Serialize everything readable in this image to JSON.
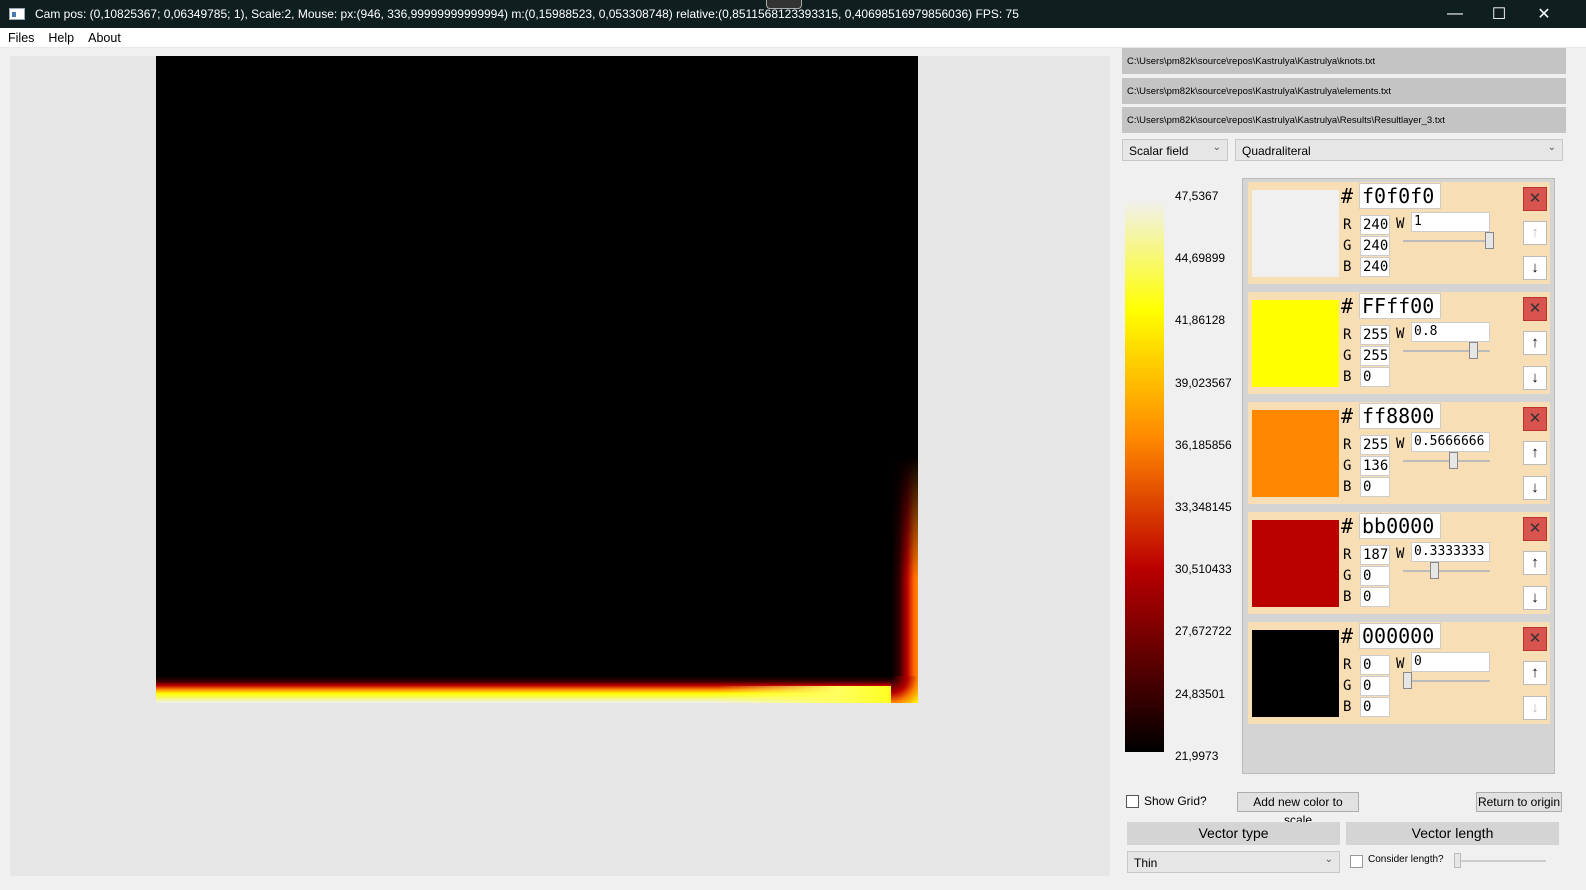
{
  "window": {
    "title": "Cam pos: (0,10825367; 0,06349785; 1), Scale:2, Mouse: px:(946, 336,99999999999994) m:(0,15988523, 0,053308748) relative:(0,8511568123393315, 0,40698516979856036) FPS: 75",
    "minimize": "—",
    "maximize": "☐",
    "close": "✕"
  },
  "menu": {
    "files": "Files",
    "help": "Help",
    "about": "About"
  },
  "files": {
    "knots": "C:\\Users\\pm82k\\source\\repos\\Kastrulya\\Kastrulya\\knots.txt",
    "elements": "C:\\Users\\pm82k\\source\\repos\\Kastrulya\\Kastrulya\\elements.txt",
    "results": "C:\\Users\\pm82k\\source\\repos\\Kastrulya\\Kastrulya\\Results\\Resultlayer_3.txt"
  },
  "display_mode": {
    "selected": "Scalar field"
  },
  "element_type": {
    "selected": "Quadraliteral"
  },
  "scale_ticks": [
    "47,5367",
    "44,69899",
    "41,86128",
    "39,023567",
    "36,185856",
    "33,348145",
    "30,510433",
    "27,672722",
    "24,83501",
    "21,9973"
  ],
  "colors": [
    {
      "hex": "f0f0f0",
      "swatch": "#f0f0f0",
      "r": "240",
      "g": "240",
      "b": "240",
      "w": "1",
      "w_value": 1.0
    },
    {
      "hex": "FFff00",
      "swatch": "#ffff00",
      "r": "255",
      "g": "255",
      "b": "0",
      "w": "0.8",
      "w_value": 0.8
    },
    {
      "hex": "ff8800",
      "swatch": "#ff8800",
      "r": "255",
      "g": "136",
      "b": "0",
      "w": "0.5666666",
      "w_value": 0.5666666
    },
    {
      "hex": "bb0000",
      "swatch": "#bb0000",
      "r": "187",
      "g": "0",
      "b": "0",
      "w": "0.3333333",
      "w_value": 0.3333333
    },
    {
      "hex": "000000",
      "swatch": "#000000",
      "r": "0",
      "g": "0",
      "b": "0",
      "w": "0",
      "w_value": 0.0
    }
  ],
  "labels": {
    "hash": "#",
    "r": "R",
    "g": "G",
    "b": "B",
    "w": "W",
    "delete_icon": "✕",
    "up_icon": "↑",
    "down_icon": "↓"
  },
  "controls": {
    "show_grid": "Show Grid?",
    "add_color": "Add new color to scale",
    "return_origin": "Return to origin",
    "vector_type": "Vector type",
    "vector_length": "Vector length",
    "vector_type_selected": "Thin",
    "consider_length": "Consider length?"
  }
}
